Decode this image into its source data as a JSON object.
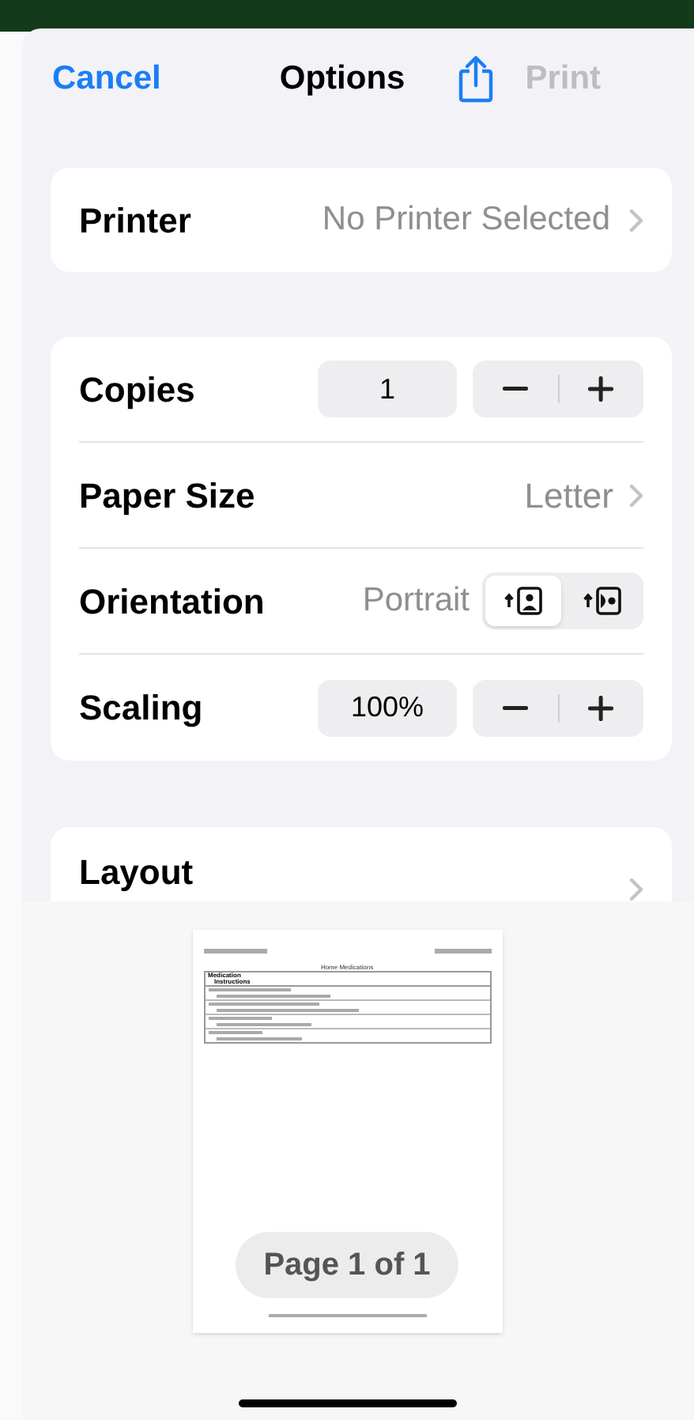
{
  "nav": {
    "cancel": "Cancel",
    "title": "Options",
    "print": {
      "label": "Print",
      "disabled": true
    }
  },
  "printer": {
    "label": "Printer",
    "value": "No Printer Selected"
  },
  "settings": [
    {
      "kind": "stepper",
      "label": "Copies",
      "value": "1"
    },
    {
      "kind": "link",
      "label": "Paper Size",
      "value": "Letter"
    },
    {
      "kind": "orientation",
      "label": "Orientation",
      "value": "Portrait",
      "options": [
        {
          "kind": "portrait",
          "selected": true
        },
        {
          "kind": "landscape",
          "selected": false
        }
      ]
    },
    {
      "kind": "stepper",
      "label": "Scaling",
      "value": "100%"
    }
  ],
  "layout": {
    "label": "Layout"
  },
  "preview": {
    "doc_title": "Home Medications",
    "columns": [
      "Medication",
      "Instructions"
    ],
    "page_label": "Page 1 of 1"
  }
}
